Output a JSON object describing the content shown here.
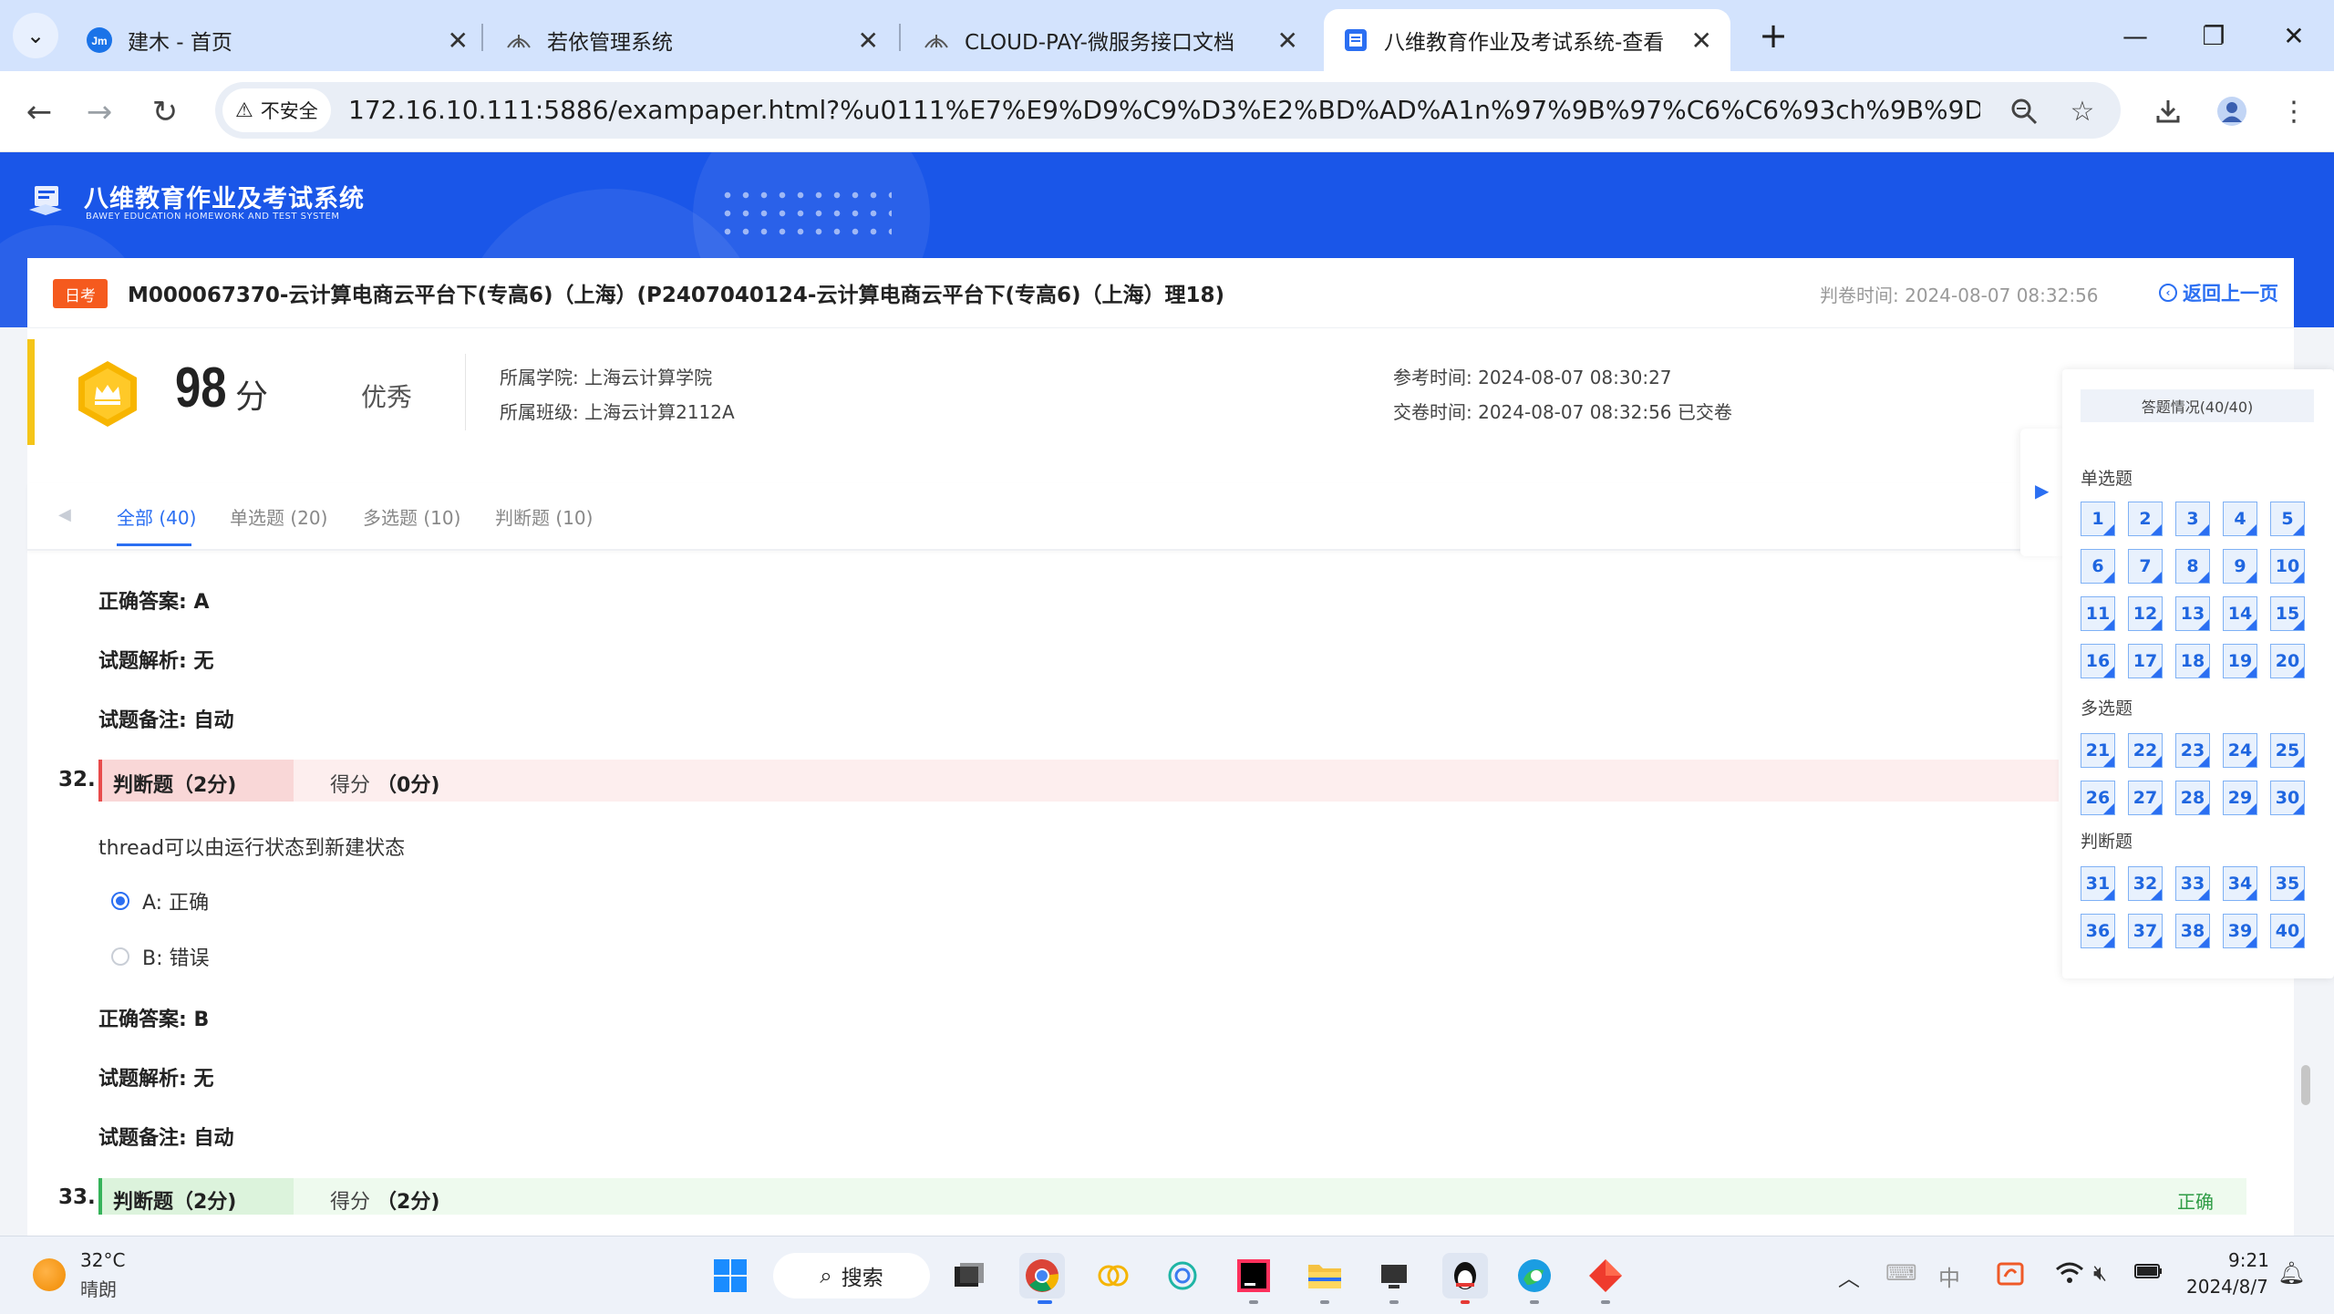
{
  "browser": {
    "tabs": [
      {
        "title": "建木 - 首页",
        "favicon": "jm-logo-icon"
      },
      {
        "title": "若依管理系统",
        "favicon": "ruoyi-leaf-icon"
      },
      {
        "title": "CLOUD-PAY-微服务接口文档",
        "favicon": "ruoyi-leaf-icon"
      },
      {
        "title": "八维教育作业及考试系统-查看",
        "favicon": "doc-icon",
        "active": true
      }
    ],
    "favicon_text": "Jm",
    "security_label": "不安全",
    "url": "172.16.10.111:5886/exampaper.html?%u0111%E7%E9%D9%C9%D3%E2%BD%AD%A1n%97%9B%97%C6%C6%93ch%9B%9D%9B%97%9..."
  },
  "header": {
    "system_name": "八维教育作业及考试系统",
    "system_name_en": "BAWEY EDUCATION HOMEWORK AND TEST SYSTEM"
  },
  "paper": {
    "badge": "日考",
    "title": "M000067370-云计算电商云平台下(专高6)（上海）(P2407040124-云计算电商云平台下(专高6)（上海）理18)",
    "judge_time_label": "判卷时间:",
    "judge_time": "2024-08-07 08:32:56",
    "back_label": "返回上一页"
  },
  "score": {
    "value": "98",
    "unit": "分",
    "grade": "优秀",
    "college_label": "所属学院:",
    "college": "上海云计算学院",
    "class_label": "所属班级:",
    "class": "上海云计算2112A",
    "start_label": "参考时间:",
    "start_time": "2024-08-07 08:30:27",
    "submit_label": "交卷时间:",
    "submit_time": "2024-08-07 08:32:56 已交卷"
  },
  "filter_tabs": [
    "全部 (40)",
    "单选题 (20)",
    "多选题 (10)",
    "判断题 (10)"
  ],
  "labels": {
    "answer": "正确答案:",
    "analysis": "试题解析:",
    "remark": "试题备注:",
    "score": "得分"
  },
  "prev_question": {
    "answer": "A",
    "analysis": "无",
    "remark": "自动"
  },
  "q32": {
    "number": "32.",
    "type": "判断题（2分)",
    "score": "（0分)",
    "text": "thread可以由运行状态到新建状态",
    "options": [
      "A: 正确",
      "B: 错误"
    ],
    "selected": 0,
    "answer": "B",
    "analysis": "无",
    "remark": "自动"
  },
  "q33": {
    "number": "33.",
    "type": "判断题（2分)",
    "score": "（2分)",
    "result": "正确"
  },
  "sheet": {
    "title": "答题情况(40/40)",
    "sections": [
      "单选题",
      "多选题",
      "判断题"
    ]
  },
  "taskbar": {
    "temperature": "32°C",
    "weather": "晴朗",
    "search": "搜索",
    "ime": "中",
    "time": "9:21",
    "date": "2024/8/7"
  },
  "colors": {
    "brand_blue": "#1a56e8",
    "accent": "#2b6ff2",
    "badge_orange": "#f55a1e",
    "wrong_bg": "#fdeeee",
    "correct_bg": "#eefaee"
  }
}
